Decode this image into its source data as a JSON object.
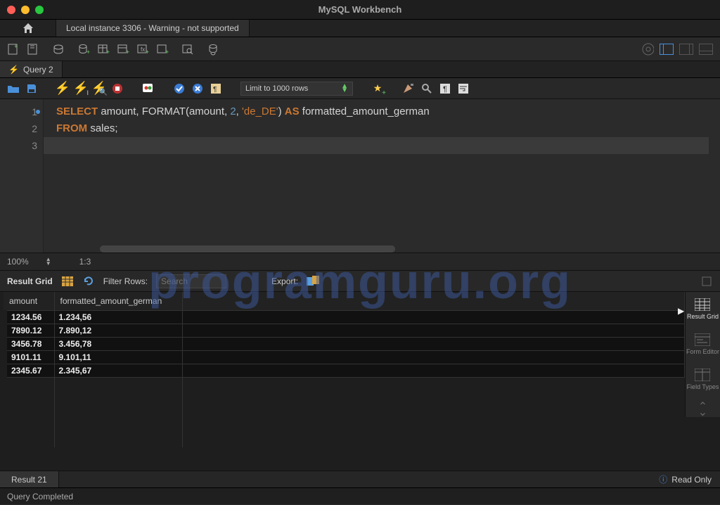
{
  "app": {
    "title": "MySQL Workbench"
  },
  "connection_tab": "Local instance 3306 - Warning - not supported",
  "query_tab": "Query 2",
  "limit_label": "Limit to 1000 rows",
  "zoom": "100%",
  "cursor_pos": "1:3",
  "sql": {
    "line1_a": "SELECT",
    "line1_b": " amount, ",
    "line1_c": "FORMAT",
    "line1_d": "(amount, ",
    "line1_e": "2",
    "line1_f": ", ",
    "line1_g": "'de_DE'",
    "line1_h": ") ",
    "line1_i": "AS",
    "line1_j": " formatted_amount_german",
    "line2_a": "FROM",
    "line2_b": " sales;"
  },
  "result_toolbar": {
    "label": "Result Grid",
    "filter_label": "Filter Rows:",
    "filter_placeholder": "Search",
    "export_label": "Export:"
  },
  "columns": [
    "amount",
    "formatted_amount_german"
  ],
  "rows": [
    {
      "amount": "1234.56",
      "fmt": "1.234,56"
    },
    {
      "amount": "7890.12",
      "fmt": "7.890,12"
    },
    {
      "amount": "3456.78",
      "fmt": "3.456,78"
    },
    {
      "amount": "9101.11",
      "fmt": "9.101,11"
    },
    {
      "amount": "2345.67",
      "fmt": "2.345,67"
    }
  ],
  "sidepanel": {
    "result_grid": "Result Grid",
    "form_editor": "Form Editor",
    "field_types": "Field Types"
  },
  "result_tab": "Result 21",
  "read_only": "Read Only",
  "status": "Query Completed",
  "watermark": "programguru.org"
}
